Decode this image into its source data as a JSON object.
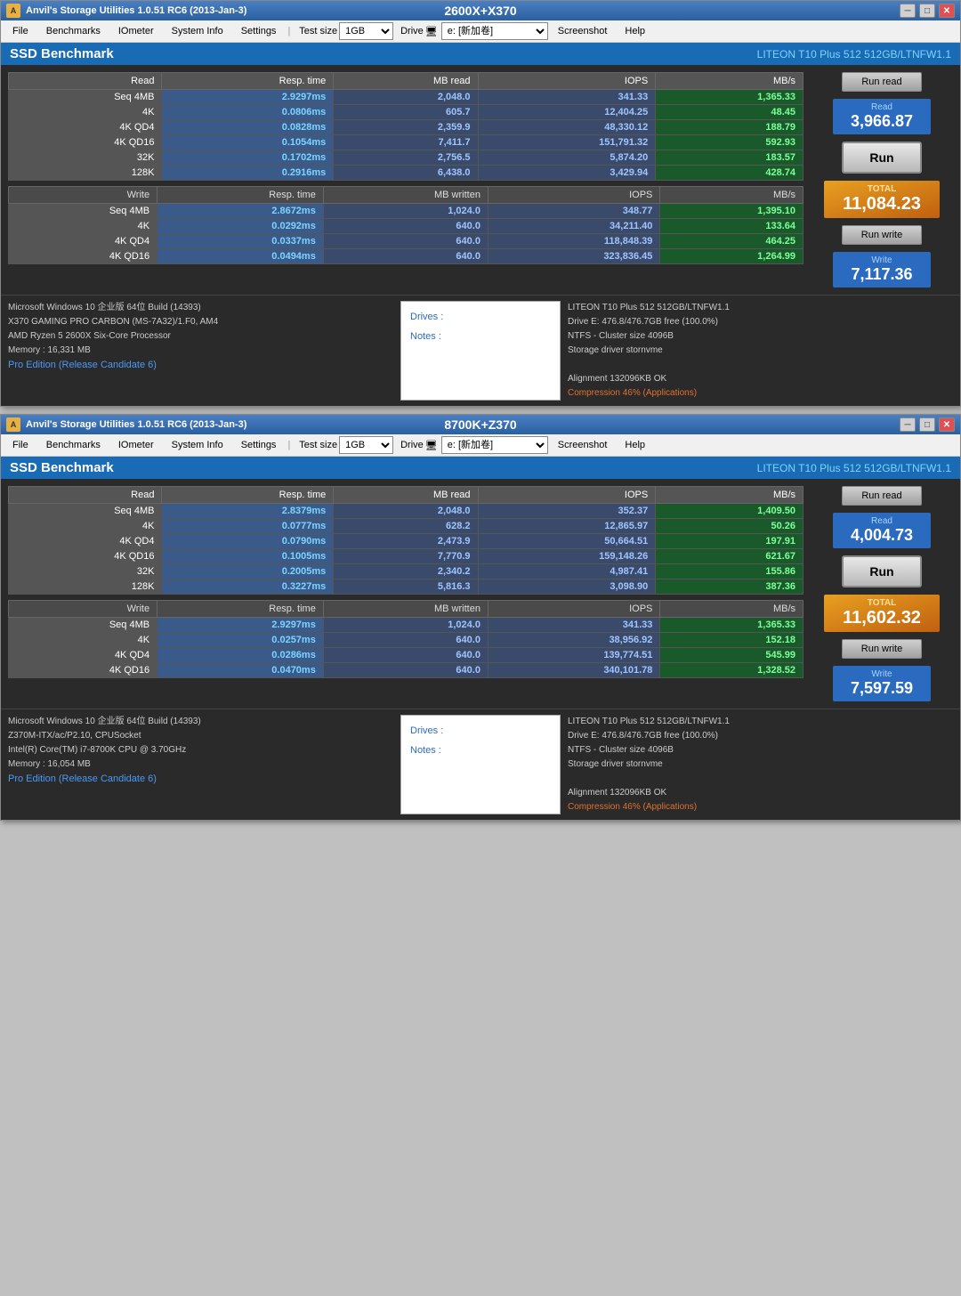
{
  "windows": [
    {
      "id": "window1",
      "app_title": "Anvil's Storage Utilities 1.0.51 RC6 (2013-Jan-3)",
      "center_title": "2600X+X370",
      "menu": [
        "File",
        "Benchmarks",
        "IOmeter",
        "System Info",
        "Settings"
      ],
      "test_size_label": "Test size",
      "test_size_value": "1GB",
      "drive_label": "Drive",
      "drive_value": "e: [新加卷]",
      "screenshot_label": "Screenshot",
      "help_label": "Help",
      "ssd_title": "SSD Benchmark",
      "drive_info": "LITEON T10 Plus 512 512GB/LTNFW1.1",
      "read_table": {
        "headers": [
          "Read",
          "Resp. time",
          "MB read",
          "IOPS",
          "MB/s"
        ],
        "rows": [
          [
            "Seq 4MB",
            "2.9297ms",
            "2,048.0",
            "341.33",
            "1,365.33"
          ],
          [
            "4K",
            "0.0806ms",
            "605.7",
            "12,404.25",
            "48.45"
          ],
          [
            "4K QD4",
            "0.0828ms",
            "2,359.9",
            "48,330.12",
            "188.79"
          ],
          [
            "4K QD16",
            "0.1054ms",
            "7,411.7",
            "151,791.32",
            "592.93"
          ],
          [
            "32K",
            "0.1702ms",
            "2,756.5",
            "5,874.20",
            "183.57"
          ],
          [
            "128K",
            "0.2916ms",
            "6,438.0",
            "3,429.94",
            "428.74"
          ]
        ]
      },
      "write_table": {
        "headers": [
          "Write",
          "Resp. time",
          "MB written",
          "IOPS",
          "MB/s"
        ],
        "rows": [
          [
            "Seq 4MB",
            "2.8672ms",
            "1,024.0",
            "348.77",
            "1,395.10"
          ],
          [
            "4K",
            "0.0292ms",
            "640.0",
            "34,211.40",
            "133.64"
          ],
          [
            "4K QD4",
            "0.0337ms",
            "640.0",
            "118,848.39",
            "464.25"
          ],
          [
            "4K QD16",
            "0.0494ms",
            "640.0",
            "323,836.45",
            "1,264.99"
          ]
        ]
      },
      "run_read_label": "Run read",
      "run_label": "Run",
      "run_write_label": "Run write",
      "read_score_label": "Read",
      "read_score_value": "3,966.87",
      "total_label": "TOTAL",
      "total_value": "11,084.23",
      "write_score_label": "Write",
      "write_score_value": "7,117.36",
      "info_sys": "Microsoft Windows 10 企业版 64位 Build (14393)\nX370 GAMING PRO CARBON (MS-7A32)/1.F0, AM4\nAMD Ryzen 5 2600X Six-Core Processor\nMemory : 16,331 MB",
      "info_pro": "Pro Edition (Release Candidate 6)",
      "drives_label": "Drives :",
      "notes_label": "Notes :",
      "info_drive": "LITEON T10 Plus 512 512GB/LTNFW1.1\nDrive E: 476.8/476.7GB free (100.0%)\nNTFS - Cluster size 4096B\nStorage driver  stornvme\n\nAlignment 132096KB OK\nCompression 46% (Applications)"
    },
    {
      "id": "window2",
      "app_title": "Anvil's Storage Utilities 1.0.51 RC6 (2013-Jan-3)",
      "center_title": "8700K+Z370",
      "menu": [
        "File",
        "Benchmarks",
        "IOmeter",
        "System Info",
        "Settings"
      ],
      "test_size_label": "Test size",
      "test_size_value": "1GB",
      "drive_label": "Drive",
      "drive_value": "e: [新加卷]",
      "screenshot_label": "Screenshot",
      "help_label": "Help",
      "ssd_title": "SSD Benchmark",
      "drive_info": "LITEON T10 Plus 512 512GB/LTNFW1.1",
      "read_table": {
        "headers": [
          "Read",
          "Resp. time",
          "MB read",
          "IOPS",
          "MB/s"
        ],
        "rows": [
          [
            "Seq 4MB",
            "2.8379ms",
            "2,048.0",
            "352.37",
            "1,409.50"
          ],
          [
            "4K",
            "0.0777ms",
            "628.2",
            "12,865.97",
            "50.26"
          ],
          [
            "4K QD4",
            "0.0790ms",
            "2,473.9",
            "50,664.51",
            "197.91"
          ],
          [
            "4K QD16",
            "0.1005ms",
            "7,770.9",
            "159,148.26",
            "621.67"
          ],
          [
            "32K",
            "0.2005ms",
            "2,340.2",
            "4,987.41",
            "155.86"
          ],
          [
            "128K",
            "0.3227ms",
            "5,816.3",
            "3,098.90",
            "387.36"
          ]
        ]
      },
      "write_table": {
        "headers": [
          "Write",
          "Resp. time",
          "MB written",
          "IOPS",
          "MB/s"
        ],
        "rows": [
          [
            "Seq 4MB",
            "2.9297ms",
            "1,024.0",
            "341.33",
            "1,365.33"
          ],
          [
            "4K",
            "0.0257ms",
            "640.0",
            "38,956.92",
            "152.18"
          ],
          [
            "4K QD4",
            "0.0286ms",
            "640.0",
            "139,774.51",
            "545.99"
          ],
          [
            "4K QD16",
            "0.0470ms",
            "640.0",
            "340,101.78",
            "1,328.52"
          ]
        ]
      },
      "run_read_label": "Run read",
      "run_label": "Run",
      "run_write_label": "Run write",
      "read_score_label": "Read",
      "read_score_value": "4,004.73",
      "total_label": "TOTAL",
      "total_value": "11,602.32",
      "write_score_label": "Write",
      "write_score_value": "7,597.59",
      "info_sys": "Microsoft Windows 10 企业版 64位 Build (14393)\nZ370M-ITX/ac/P2.10, CPUSocket\nIntel(R) Core(TM) i7-8700K CPU @ 3.70GHz\nMemory : 16,054 MB",
      "info_pro": "Pro Edition (Release Candidate 6)",
      "drives_label": "Drives :",
      "notes_label": "Notes :",
      "info_drive": "LITEON T10 Plus 512 512GB/LTNFW1.1\nDrive E: 476.8/476.7GB free (100.0%)\nNTFS - Cluster size 4096B\nStorage driver  stornvme\n\nAlignment 132096KB OK\nCompression 46% (Applications)"
    }
  ]
}
